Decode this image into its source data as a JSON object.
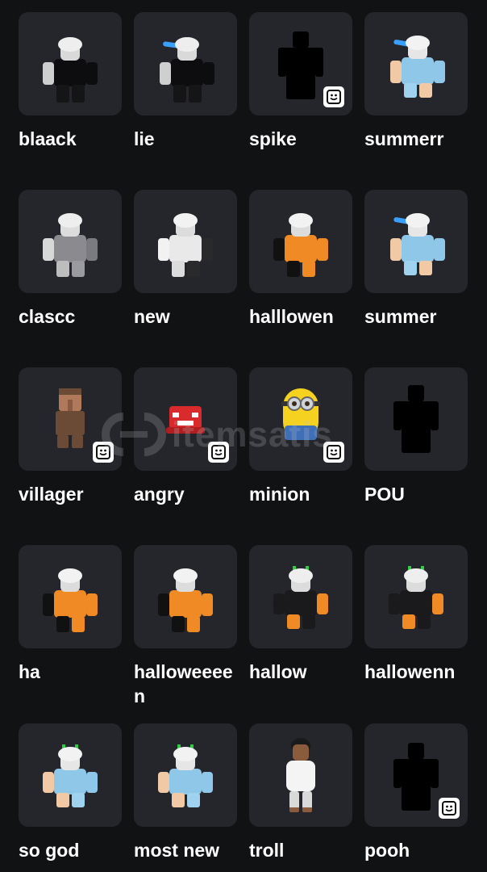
{
  "items": [
    {
      "name": "blaack",
      "avatar": "avatar-black-outfit",
      "emote": false
    },
    {
      "name": "lie",
      "avatar": "avatar-black-outfit-sword",
      "emote": false
    },
    {
      "name": "spike",
      "avatar": "avatar-silhouette",
      "emote": true
    },
    {
      "name": "summerr",
      "avatar": "avatar-blue-outfit-sword",
      "emote": false
    },
    {
      "name": "clascc",
      "avatar": "avatar-grey-outfit",
      "emote": false
    },
    {
      "name": "new",
      "avatar": "avatar-white-outfit",
      "emote": false
    },
    {
      "name": "halllowen",
      "avatar": "avatar-orange-outfit",
      "emote": false
    },
    {
      "name": "summer",
      "avatar": "avatar-blue-outfit-sword",
      "emote": false
    },
    {
      "name": "villager",
      "avatar": "avatar-villager",
      "emote": true
    },
    {
      "name": "angry",
      "avatar": "avatar-angry",
      "emote": true
    },
    {
      "name": "minion",
      "avatar": "avatar-minion",
      "emote": true
    },
    {
      "name": "POU",
      "avatar": "avatar-silhouette",
      "emote": false
    },
    {
      "name": "ha",
      "avatar": "avatar-orange-outfit",
      "emote": false
    },
    {
      "name": "halloweeeen",
      "avatar": "avatar-orange-outfit",
      "emote": false
    },
    {
      "name": "hallow",
      "avatar": "avatar-orange-outfit-green",
      "emote": false
    },
    {
      "name": "hallowenn",
      "avatar": "avatar-orange-outfit-green",
      "emote": false
    },
    {
      "name": "so god",
      "avatar": "avatar-blue-outfit-green",
      "emote": false
    },
    {
      "name": "most new",
      "avatar": "avatar-blue-outfit-green",
      "emote": false
    },
    {
      "name": "troll",
      "avatar": "avatar-troll",
      "emote": false
    },
    {
      "name": "pooh",
      "avatar": "avatar-silhouette",
      "emote": true
    }
  ],
  "watermark": {
    "text": "itemsatis"
  },
  "colors": {
    "background": "#111214",
    "tile": "#25262b",
    "text": "#ffffff"
  }
}
